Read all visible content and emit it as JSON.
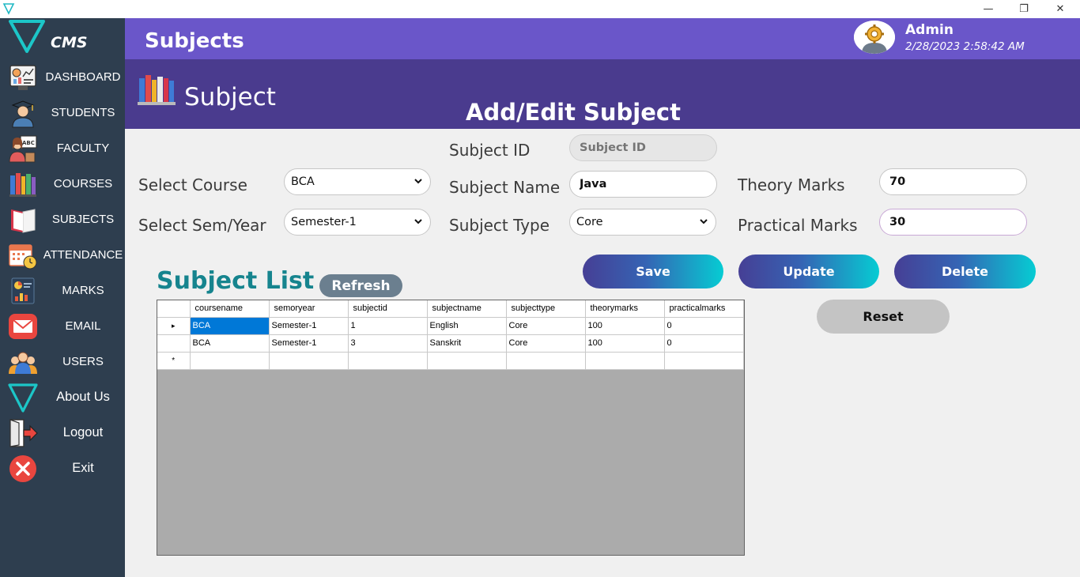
{
  "window": {
    "minimize": "—",
    "maximize": "❐",
    "close": "✕"
  },
  "logo": {
    "text": "CMS"
  },
  "sidebar": {
    "items": [
      {
        "label": "DASHBOARD",
        "icon": "dashboard-icon"
      },
      {
        "label": "STUDENTS",
        "icon": "student-icon"
      },
      {
        "label": "FACULTY",
        "icon": "faculty-icon"
      },
      {
        "label": "COURSES",
        "icon": "books-icon"
      },
      {
        "label": "SUBJECTS",
        "icon": "book-icon"
      },
      {
        "label": "ATTENDANCE",
        "icon": "calendar-icon"
      },
      {
        "label": "MARKS",
        "icon": "report-icon"
      },
      {
        "label": "EMAIL",
        "icon": "mail-icon"
      },
      {
        "label": "USERS",
        "icon": "users-icon"
      },
      {
        "label": "About Us",
        "icon": "logo-icon"
      },
      {
        "label": "Logout",
        "icon": "logout-icon"
      },
      {
        "label": "Exit",
        "icon": "exit-icon"
      }
    ]
  },
  "header": {
    "title": "Subjects",
    "admin_name": "Admin",
    "datetime": "2/28/2023 2:58:42 AM"
  },
  "banner": {
    "title": "Subject",
    "heading": "Add/Edit Subject"
  },
  "form": {
    "subject_id_label": "Subject ID",
    "subject_id_placeholder": "Subject ID",
    "select_course_label": "Select Course",
    "select_course_value": "BCA",
    "subject_name_label": "Subject Name",
    "subject_name_value": "Java",
    "theory_marks_label": "Theory Marks",
    "theory_marks_value": "70",
    "select_sem_label": "Select Sem/Year",
    "select_sem_value": "Semester-1",
    "subject_type_label": "Subject Type",
    "subject_type_value": "Core",
    "practical_marks_label": "Practical Marks",
    "practical_marks_value": "30"
  },
  "buttons": {
    "save": "Save",
    "update": "Update",
    "delete": "Delete",
    "reset": "Reset",
    "refresh": "Refresh"
  },
  "list": {
    "title": "Subject List",
    "columns": [
      "coursename",
      "semoryear",
      "subjectid",
      "subjectname",
      "subjecttype",
      "theorymarks",
      "practicalmarks"
    ],
    "rows": [
      [
        "BCA",
        "Semester-1",
        "1",
        "English",
        "Core",
        "100",
        "0"
      ],
      [
        "BCA",
        "Semester-1",
        "3",
        "Sanskrit",
        "Core",
        "100",
        "0"
      ]
    ],
    "current_row_marker": "▸",
    "new_row_marker": "*"
  },
  "colors": {
    "sidebar": "#2e3e4f",
    "header": "#6a56c9",
    "banner": "#4a3b8e",
    "accent_teal": "#16848e",
    "selection": "#0078d7"
  }
}
